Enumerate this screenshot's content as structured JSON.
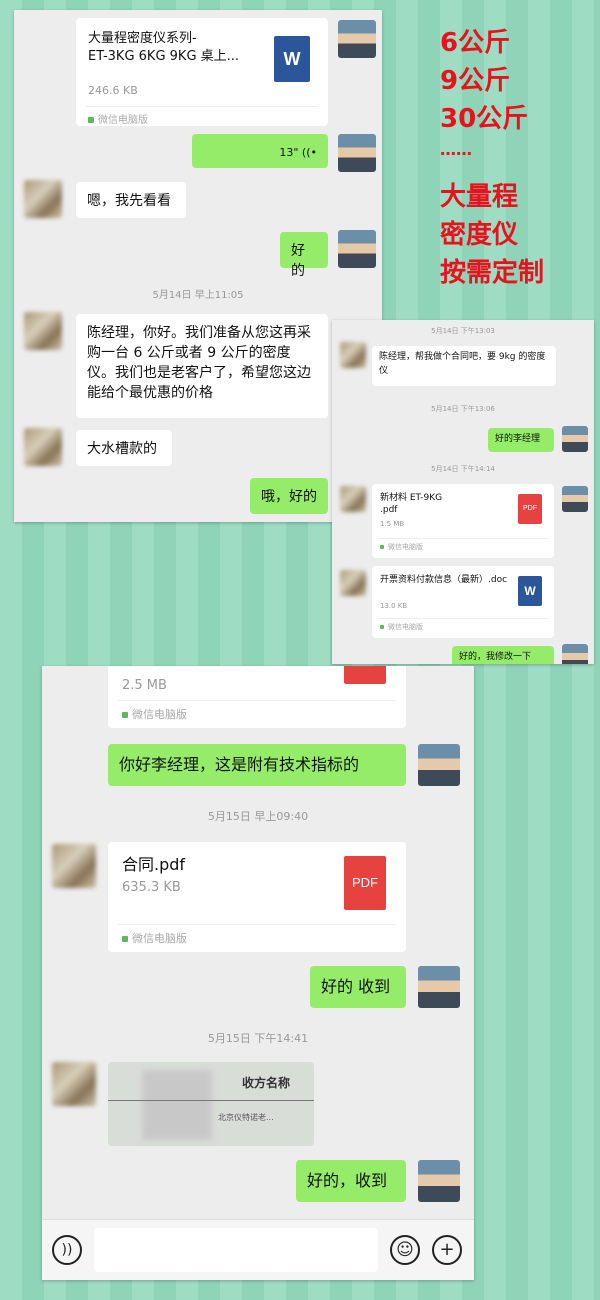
{
  "panel1": {
    "file1": {
      "name": "大量程密度仪系列-\nET-3KG 6KG 9KG 桌上...",
      "size": "246.6 KB",
      "source": "微信电脑版",
      "icon": "W"
    },
    "voice": "13\" ((•",
    "msg1": "嗯，我先看看",
    "msg2": "好的",
    "ts1": "5月14日 早上11:05",
    "msg3": "陈经理，你好。我们准备从您这再采购一台 6 公斤或者 9 公斤的密度仪。我们也是老客户了，希望您这边能给个最优惠的价格",
    "msg4": "大水槽款的",
    "msg5": "哦，好的"
  },
  "promo": {
    "lines": [
      "6公斤",
      "9公斤",
      "30公斤",
      "……",
      "大量程",
      "密度仪",
      "按需定制"
    ],
    "color": "#e8121c"
  },
  "panel2": {
    "ts1": "5月14日 下午13:03",
    "msg1": "陈经理，帮我做个合同吧，要 9kg 的密度仪",
    "ts2": "5月14日 下午13:06",
    "msg2": "好的李经理",
    "ts3": "5月14日 下午14:14",
    "file1": {
      "name": "新材料 ET-9KG\n.pdf",
      "size": "1.5 MB",
      "source": "微信电脑版",
      "icon": "PDF"
    },
    "file2": {
      "name": "开票资料付款信息（最新）.doc",
      "size": "13.0 KB",
      "source": "微信电脑版",
      "icon": "W"
    },
    "msg3": "好的，我修改一下"
  },
  "panel3": {
    "file0": {
      "size": "2.5 MB",
      "source": "微信电脑版"
    },
    "msg1": "你好李经理，这是附有技术指标的",
    "ts1": "5月15日 早上09:40",
    "file1": {
      "name": "合同.pdf",
      "size": "635.3 KB",
      "source": "微信电脑版",
      "icon": "PDF"
    },
    "msg2": "好的 收到",
    "ts2": "5月15日 下午14:41",
    "image_text": {
      "header": "收方名称",
      "body": "北京仪特诺老..."
    },
    "msg3": "好的，收到",
    "toolbar": {
      "voice_icon": "voice-icon",
      "emoji_icon": "emoji-icon",
      "plus_icon": "plus-icon"
    }
  }
}
